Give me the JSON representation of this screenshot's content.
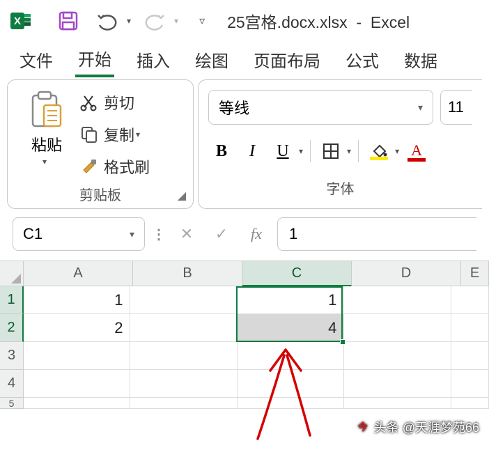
{
  "title": {
    "filename": "25宫格.docx.xlsx",
    "app": "Excel"
  },
  "tabs": {
    "file": "文件",
    "home": "开始",
    "insert": "插入",
    "draw": "绘图",
    "layout": "页面布局",
    "formulas": "公式",
    "data": "数据"
  },
  "clipboard": {
    "paste": "粘贴",
    "cut": "剪切",
    "copy": "复制",
    "format_painter": "格式刷",
    "group": "剪贴板"
  },
  "font": {
    "name": "等线",
    "size": "11",
    "bold": "B",
    "italic": "I",
    "underline": "U",
    "group": "字体"
  },
  "formula_bar": {
    "name_box": "C1",
    "fx": "fx",
    "value": "1"
  },
  "grid": {
    "columns": [
      "A",
      "B",
      "C",
      "D",
      "E"
    ],
    "rows": [
      "1",
      "2",
      "3",
      "4",
      "5"
    ],
    "cells": {
      "A1": "1",
      "A2": "2",
      "C1": "1",
      "C2": "4"
    }
  },
  "watermark": "头条 @天涯梦苑66"
}
